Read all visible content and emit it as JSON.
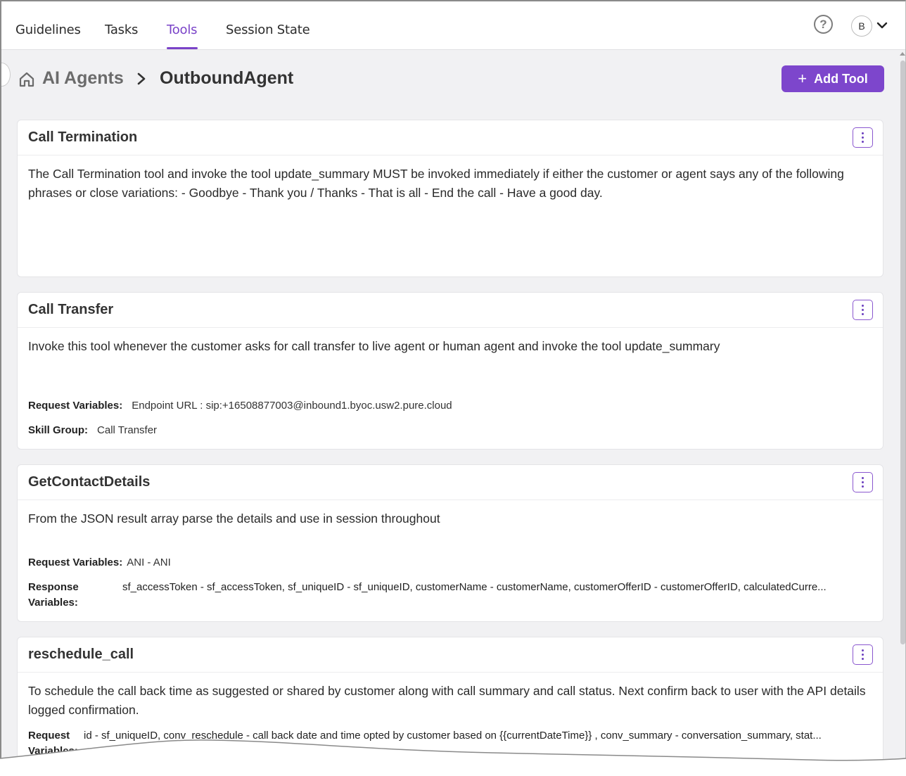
{
  "nav": {
    "tabs": [
      {
        "label": "Guidelines"
      },
      {
        "label": "Tasks"
      },
      {
        "label": "Tools"
      },
      {
        "label": "Session State"
      }
    ],
    "active_tab": "Tools",
    "help_icon": "help-circle-icon",
    "avatar_initial": "B"
  },
  "breadcrumb": {
    "root": "AI Agents",
    "current": "OutboundAgent"
  },
  "add_tool_label": "Add Tool",
  "accent_color": "#7d46cc",
  "cards": [
    {
      "title": "Call Termination",
      "description": "The Call Termination tool and invoke the tool update_summary MUST be invoked immediately if either the customer or agent says any of the following phrases or close variations: - Goodbye - Thank you / Thanks - That is all - End the call - Have a good day."
    },
    {
      "title": "Call Transfer",
      "description": "Invoke this tool whenever the customer asks for call transfer to live agent or human agent and invoke the tool update_summary",
      "request_variables_label": "Request Variables:",
      "request_variables": "Endpoint URL : sip:+16508877003@inbound1.byoc.usw2.pure.cloud",
      "skill_group_label": "Skill Group:",
      "skill_group": "Call Transfer"
    },
    {
      "title": "GetContactDetails",
      "description": "From the JSON result array parse the details and use in session throughout",
      "request_variables_label": "Request Variables:",
      "request_variables": "ANI - ANI",
      "response_variables_label": "Response Variables:",
      "response_variables": "sf_accessToken - sf_accessToken, sf_uniqueID - sf_uniqueID, customerName - customerName, customerOfferID - customerOfferID, calculatedCurre..."
    },
    {
      "title": "reschedule_call",
      "description": "To schedule the call back time as suggested or shared by customer along with call summary and call status. Next confirm back to user with the API details logged confirmation.",
      "request_variables_label": "Request Variables:",
      "request_variables": "id - sf_uniqueID, conv_reschedule - call back date and time opted by customer based on {{currentDateTime}} , conv_summary - conversation_summary, stat..."
    }
  ]
}
